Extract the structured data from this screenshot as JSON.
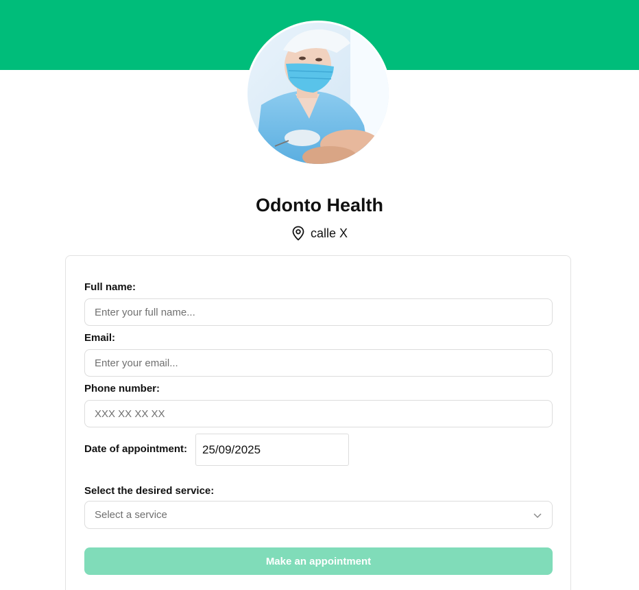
{
  "clinic": {
    "name": "Odonto Health",
    "address": "calle X"
  },
  "icons": {
    "location": "map-pin-icon",
    "dropdown": "chevron-down-icon"
  },
  "colors": {
    "banner": "#00bd7a",
    "button_disabled": "#80dcb9"
  },
  "form": {
    "full_name": {
      "label": "Full name:",
      "placeholder": "Enter your full name..."
    },
    "email": {
      "label": "Email:",
      "placeholder": "Enter your email..."
    },
    "phone": {
      "label": "Phone number:",
      "placeholder": "XXX XX XX XX"
    },
    "date": {
      "label": "Date of appointment:",
      "value": "25/09/2025"
    },
    "service": {
      "label": "Select the desired service:",
      "placeholder": "Select a service"
    },
    "submit_label": "Make an appointment"
  }
}
